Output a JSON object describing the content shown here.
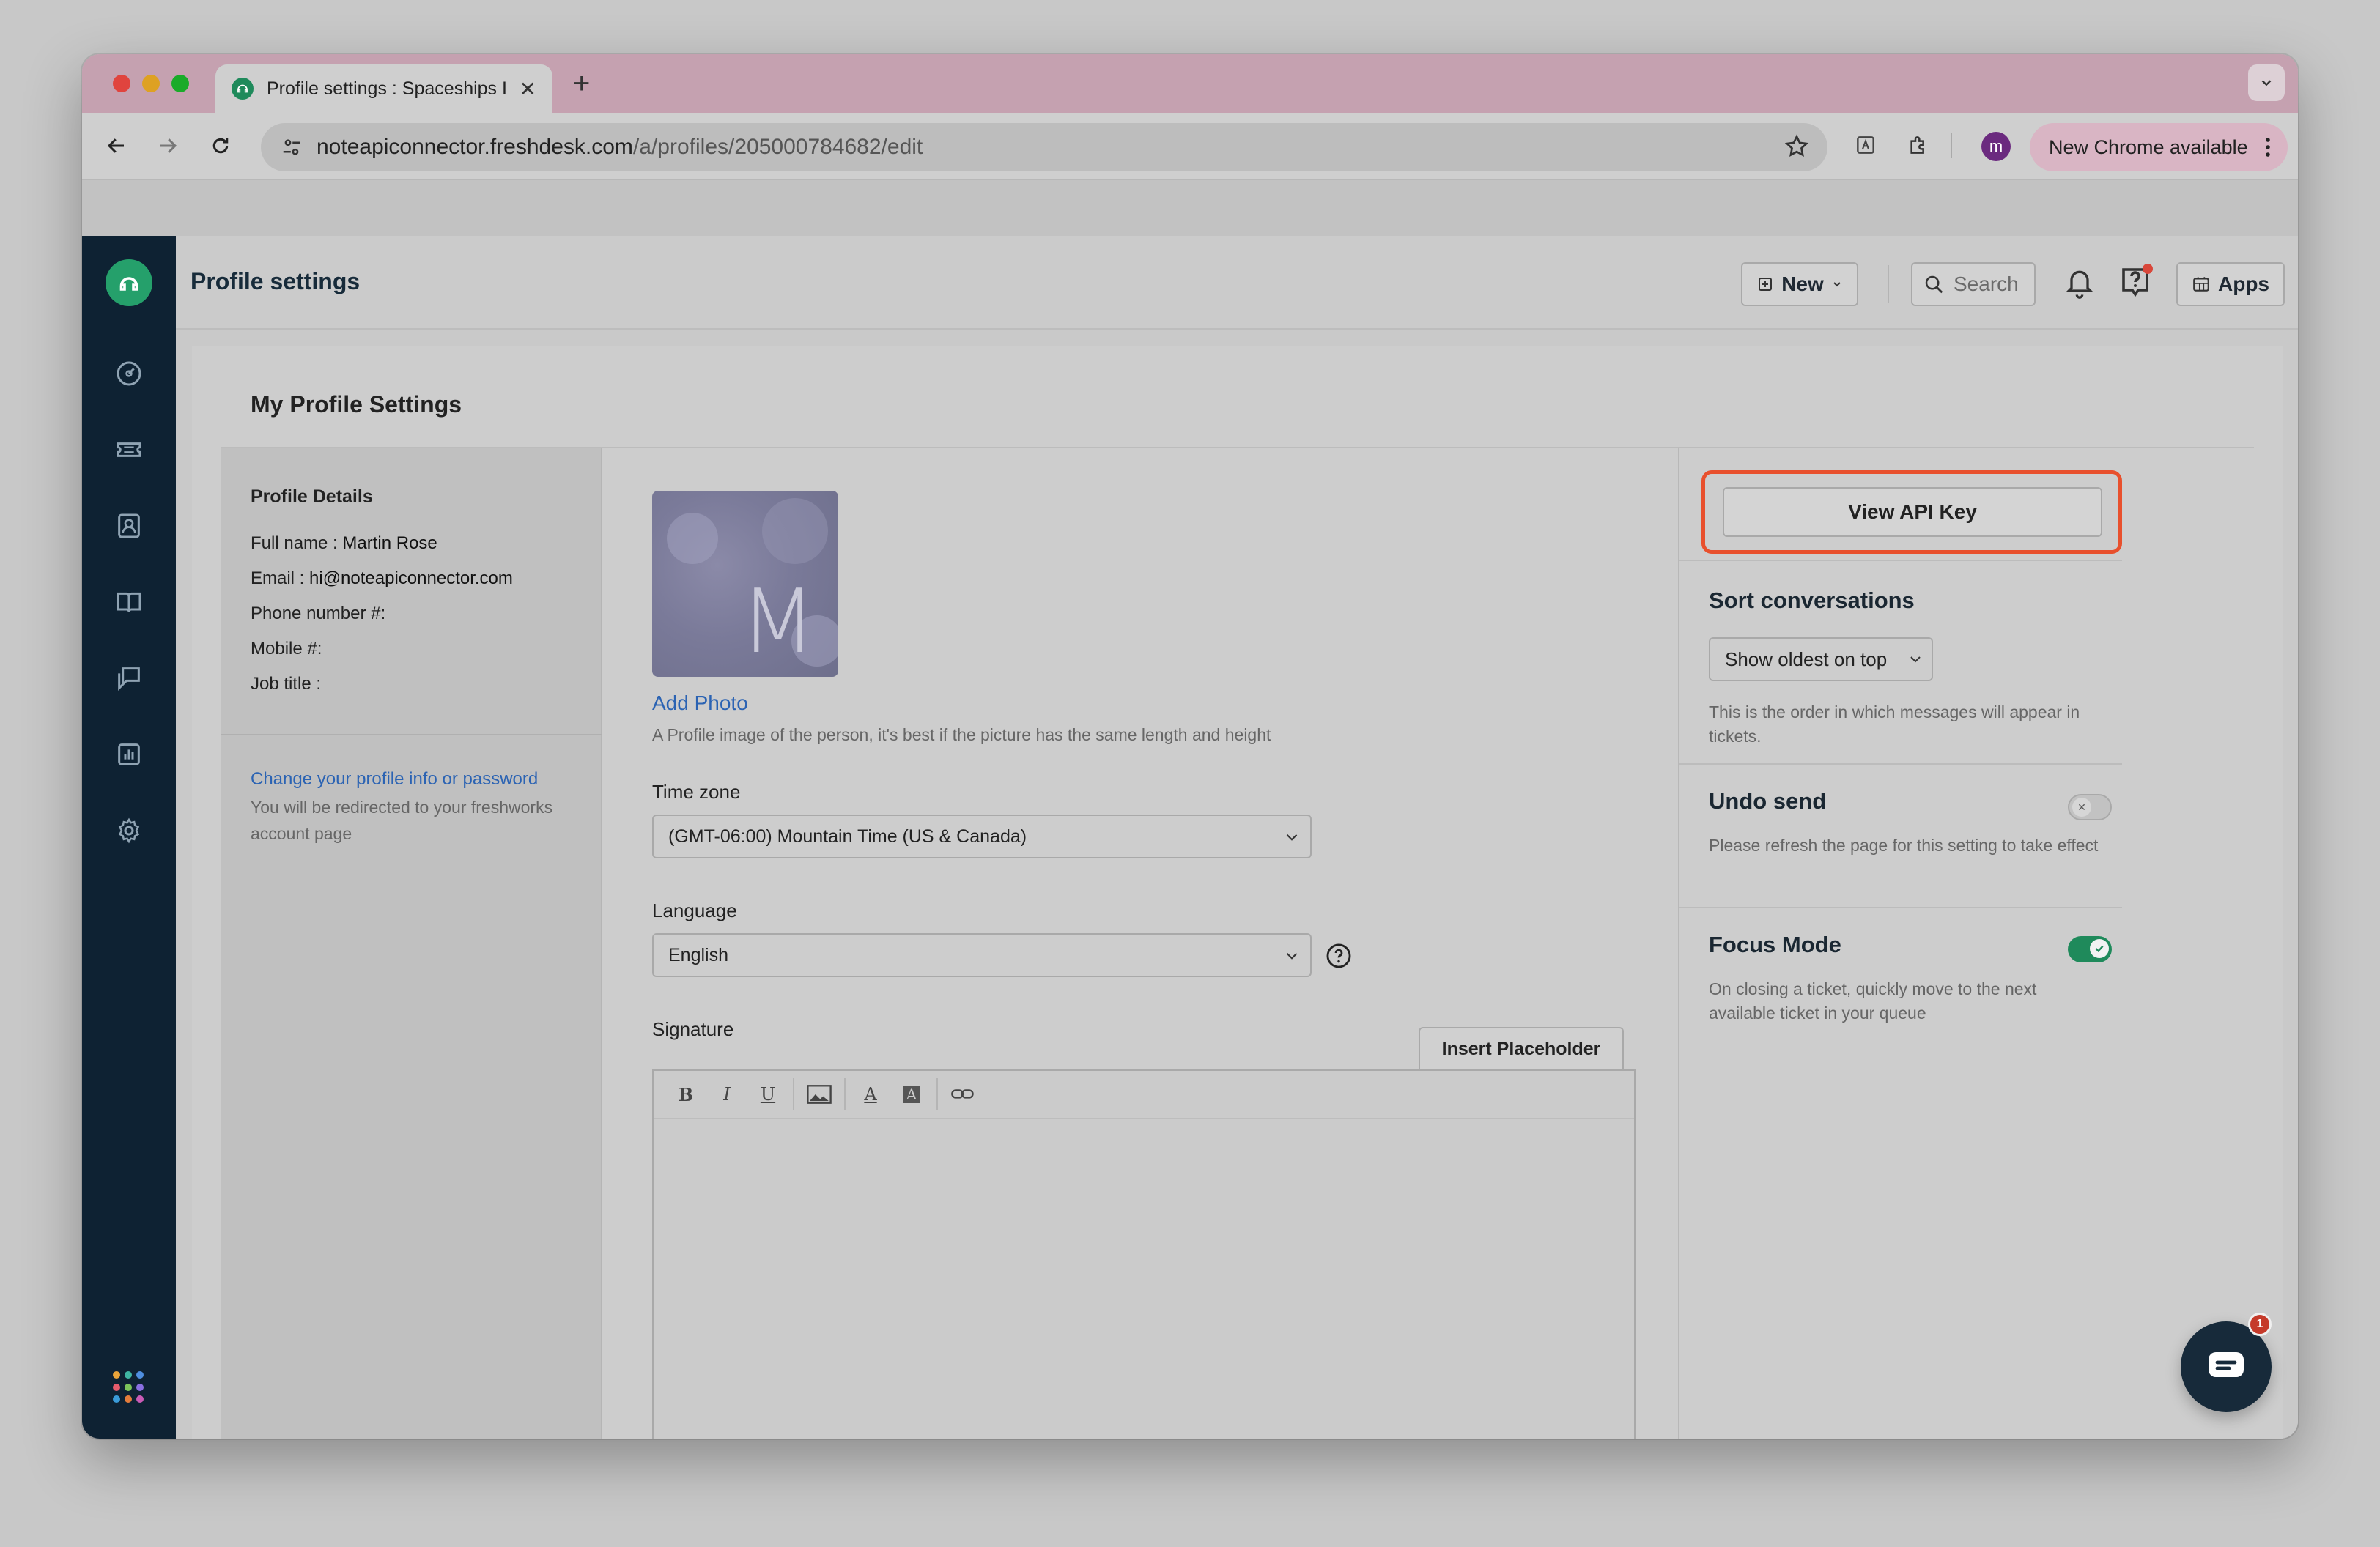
{
  "browser": {
    "tab_title": "Profile settings : Spaceships I",
    "url_host": "noteapiconnector.freshdesk.com",
    "url_path": "/a/profiles/205000784682/edit",
    "profile_initial": "m",
    "update_label": "New Chrome available"
  },
  "header": {
    "title": "Profile settings",
    "new_label": "New",
    "search_placeholder": "Search",
    "apps_label": "Apps",
    "avatar_initial": "M"
  },
  "page": {
    "heading": "My Profile Settings"
  },
  "profile_details": {
    "title": "Profile Details",
    "full_name_label": "Full name : ",
    "full_name": "Martin Rose",
    "email_label": "Email : ",
    "email": "hi@noteapiconnector.com",
    "phone_label": "Phone number #:",
    "mobile_label": "Mobile #:",
    "job_title_label": "Job title :",
    "change_link": "Change your profile info or password",
    "redirect_note": "You will be redirected to your freshworks account page"
  },
  "profile_form": {
    "avatar_letter": "M",
    "add_photo": "Add Photo",
    "photo_hint": "A Profile image of the person, it's best if the picture has the same length and height",
    "timezone_label": "Time zone",
    "timezone_value": "(GMT-06:00) Mountain Time (US & Canada)",
    "language_label": "Language",
    "language_value": "English",
    "signature_label": "Signature",
    "insert_placeholder": "Insert Placeholder",
    "editor_tools": {
      "bold": "B",
      "italic": "I",
      "underline": "U",
      "font_color": "A",
      "bg_color": "A"
    }
  },
  "settings": {
    "api_button": "View API Key",
    "sort_title": "Sort conversations",
    "sort_value": "Show oldest on top",
    "sort_desc": "This is the order in which messages will appear in tickets.",
    "undo_title": "Undo send",
    "undo_enabled": false,
    "undo_desc": "Please refresh the page for this setting to take effect",
    "focus_title": "Focus Mode",
    "focus_enabled": true,
    "focus_desc": "On closing a ticket, quickly move to the next available ticket in your queue"
  },
  "chat": {
    "badge_count": "1"
  },
  "colors": {
    "sidebar": "#0e2233",
    "brand_green": "#25a06b",
    "link_blue": "#2b63b3",
    "highlight_orange": "#e8502d",
    "toggle_on": "#1f8a5b"
  }
}
